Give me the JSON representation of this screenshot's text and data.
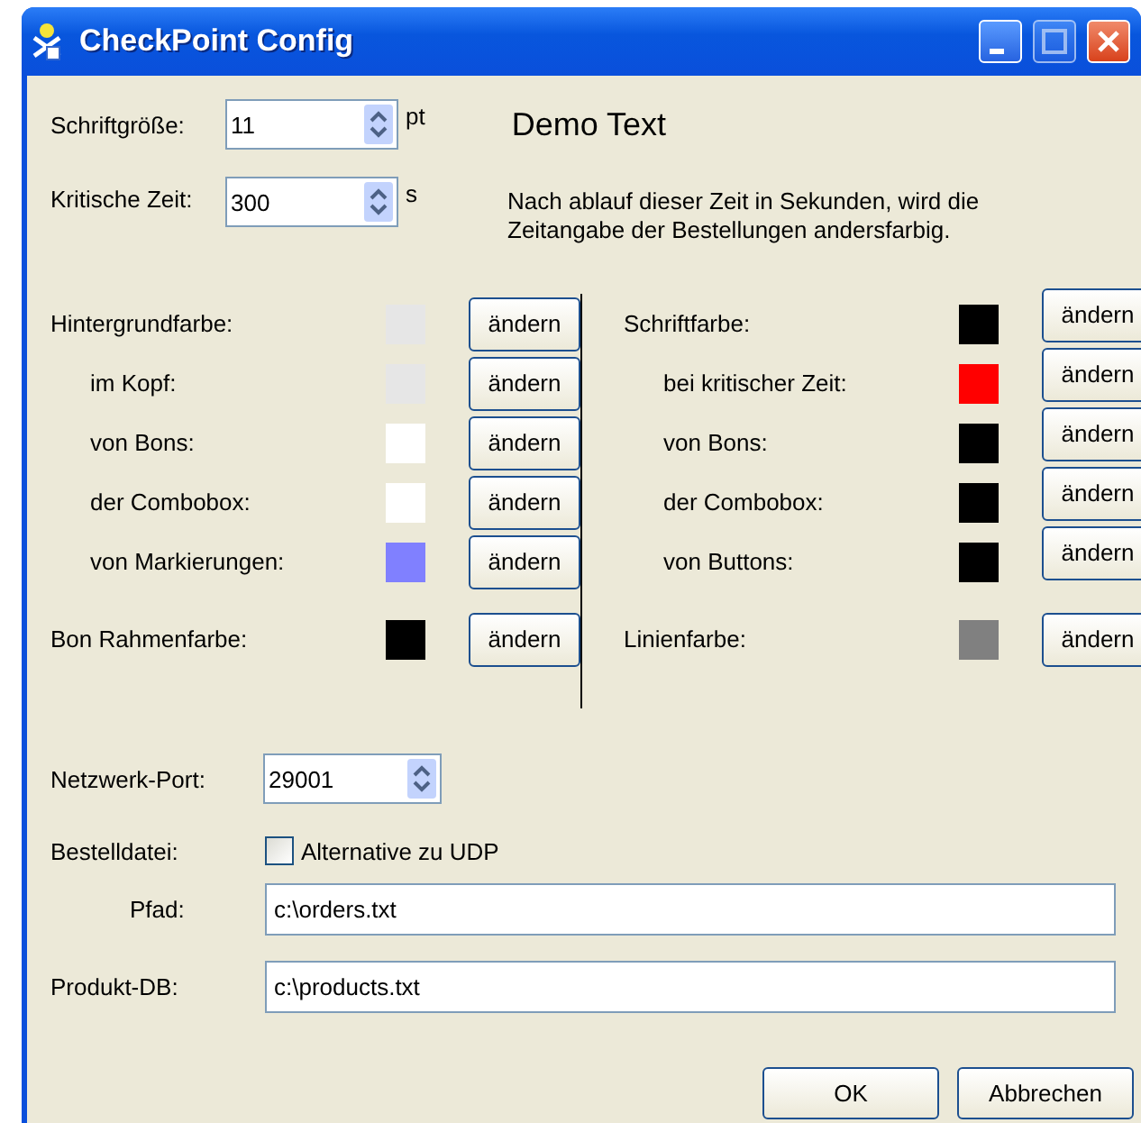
{
  "window": {
    "title": "CheckPoint Config"
  },
  "font_size": {
    "label": "Schriftgröße:",
    "value": "11",
    "unit": "pt"
  },
  "demo_text": "Demo Text",
  "critical_time": {
    "label": "Kritische Zeit:",
    "value": "300",
    "unit": "s",
    "note": "Nach ablauf dieser Zeit in Sekunden, wird die Zeitangabe der Bestellungen andersfarbig."
  },
  "left_colors": [
    {
      "kind": "main",
      "label": "Hintergrundfarbe:",
      "color": "#e6e6e6",
      "button": "ändern"
    },
    {
      "kind": "sub",
      "label": "im Kopf:",
      "color": "#e6e6e6",
      "button": "ändern"
    },
    {
      "kind": "sub",
      "label": "von Bons:",
      "color": "#ffffff",
      "button": "ändern"
    },
    {
      "kind": "sub",
      "label": "der Combobox:",
      "color": "#ffffff",
      "button": "ändern"
    },
    {
      "kind": "sub",
      "label": "von Markierungen:",
      "color": "#8080ff",
      "button": "ändern"
    },
    {
      "kind": "separate",
      "label": "Bon Rahmenfarbe:",
      "color": "#000000",
      "button": "ändern"
    }
  ],
  "right_colors": [
    {
      "kind": "main",
      "label": "Schriftfarbe:",
      "color": "#000000",
      "button": "ändern"
    },
    {
      "kind": "sub",
      "label": "bei kritischer Zeit:",
      "color": "#ff0000",
      "button": "ändern"
    },
    {
      "kind": "sub",
      "label": "von Bons:",
      "color": "#000000",
      "button": "ändern"
    },
    {
      "kind": "sub",
      "label": "der Combobox:",
      "color": "#000000",
      "button": "ändern"
    },
    {
      "kind": "sub",
      "label": "von Buttons:",
      "color": "#000000",
      "button": "ändern"
    },
    {
      "kind": "separate",
      "label": "Linienfarbe:",
      "color": "#808080",
      "button": "ändern"
    }
  ],
  "network_port": {
    "label": "Netzwerk-Port:",
    "value": "29001"
  },
  "order_file": {
    "label": "Bestelldatei:",
    "checkbox": {
      "label": "Alternative zu UDP",
      "checked": false
    },
    "path_label": "Pfad:",
    "path": "c:\\orders.txt"
  },
  "product_db": {
    "label": "Produkt-DB:",
    "value": "c:\\products.txt"
  },
  "buttons": [
    "OK",
    "Abbrechen"
  ]
}
